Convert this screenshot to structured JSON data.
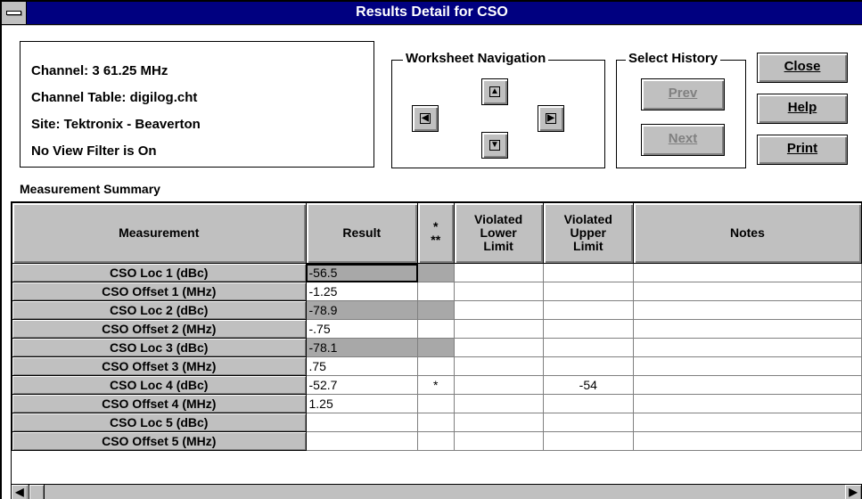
{
  "window": {
    "title": "Results Detail for CSO"
  },
  "info": {
    "channel": "Channel:  3  61.25 MHz",
    "channel_table": "Channel Table:  digilog.cht",
    "site": "Site:  Tektronix - Beaverton",
    "filter": "No View Filter is On"
  },
  "navigation": {
    "label": "Worksheet Navigation",
    "icons": {
      "left": "arrow-left-icon",
      "up": "arrow-up-icon",
      "down": "arrow-down-icon",
      "right": "arrow-right-icon"
    }
  },
  "history": {
    "label": "Select History",
    "prev_label": "Prev",
    "next_label": "Next"
  },
  "buttons": {
    "close_label": "Close",
    "help_label": "Help",
    "print_label": "Print"
  },
  "summary_label": "Measurement Summary",
  "table": {
    "headers": {
      "measurement": "Measurement",
      "result": "Result",
      "flag_line1": "*",
      "flag_line2": "**",
      "lower_line1": "Violated",
      "lower_line2": "Lower",
      "lower_line3": "Limit",
      "upper_line1": "Violated",
      "upper_line2": "Upper",
      "upper_line3": "Limit",
      "notes": "Notes"
    },
    "rows": [
      {
        "name": "CSO Loc 1 (dBc)",
        "result": "-56.5",
        "flag": "",
        "lower": "",
        "upper": "",
        "notes": ""
      },
      {
        "name": "CSO Offset 1 (MHz)",
        "result": "-1.25",
        "flag": "",
        "lower": "",
        "upper": "",
        "notes": ""
      },
      {
        "name": "CSO Loc 2 (dBc)",
        "result": "-78.9",
        "flag": "",
        "lower": "",
        "upper": "",
        "notes": ""
      },
      {
        "name": "CSO Offset 2 (MHz)",
        "result": "-.75",
        "flag": "",
        "lower": "",
        "upper": "",
        "notes": ""
      },
      {
        "name": "CSO Loc 3 (dBc)",
        "result": "-78.1",
        "flag": "",
        "lower": "",
        "upper": "",
        "notes": ""
      },
      {
        "name": "CSO Offset 3 (MHz)",
        "result": ".75",
        "flag": "",
        "lower": "",
        "upper": "",
        "notes": ""
      },
      {
        "name": "CSO Loc 4 (dBc)",
        "result": "-52.7",
        "flag": "*",
        "lower": "",
        "upper": "-54",
        "notes": ""
      },
      {
        "name": "CSO Offset 4 (MHz)",
        "result": "1.25",
        "flag": "",
        "lower": "",
        "upper": "",
        "notes": ""
      },
      {
        "name": "CSO Loc 5 (dBc)",
        "result": "",
        "flag": "",
        "lower": "",
        "upper": "",
        "notes": ""
      },
      {
        "name": "CSO Offset 5 (MHz)",
        "result": "",
        "flag": "",
        "lower": "",
        "upper": "",
        "notes": ""
      }
    ]
  },
  "scrollbar": {
    "left_icon": "scroll-left-icon",
    "right_icon": "scroll-right-icon"
  },
  "colors": {
    "titlebar": "#000080",
    "shaded_cell": "#a8a8a8",
    "face": "#c0c0c0"
  }
}
